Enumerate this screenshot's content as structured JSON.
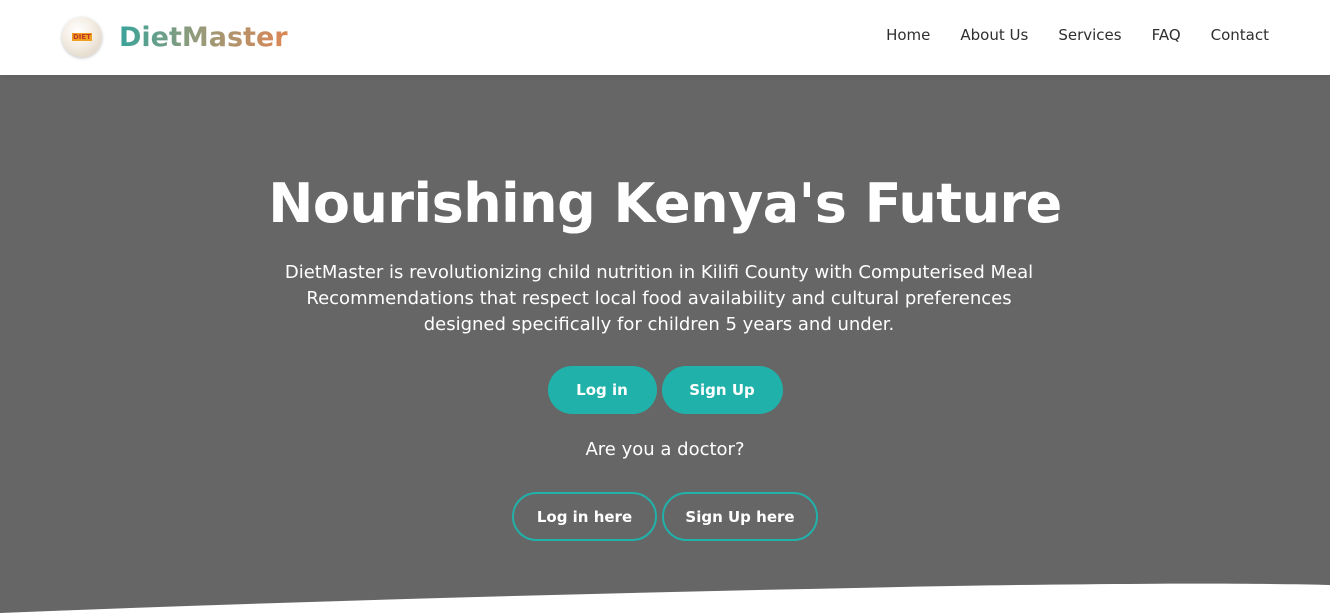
{
  "brand": {
    "logo_text": "DIET",
    "name": "DietMaster"
  },
  "nav": {
    "links": [
      "Home",
      "About Us",
      "Services",
      "FAQ",
      "Contact"
    ]
  },
  "hero": {
    "title": "Nourishing Kenya's Future",
    "description": "DietMaster is revolutionizing child nutrition in Kilifi County with Computerised Meal Recommendations that respect local food availability and cultural preferences designed specifically for children 5 years and under.",
    "login_label": "Log in",
    "signup_label": "Sign Up",
    "doctor_question": "Are you a doctor?",
    "doctor_login_label": "Log in here",
    "doctor_signup_label": "Sign Up here"
  },
  "colors": {
    "accent": "#20b2aa",
    "hero_bg": "#666666",
    "brand_gradient": [
      "#3aa39a",
      "#dd8655"
    ]
  }
}
